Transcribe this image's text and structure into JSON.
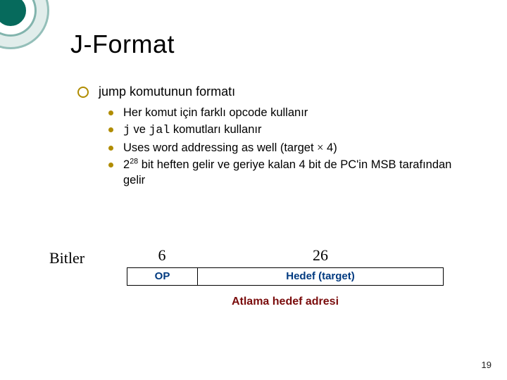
{
  "title": "J-Format",
  "lvl1_text": "jump komutunun formatı",
  "sub": {
    "a": "Her komut için farklı opcode kullanır",
    "b_pre": "j",
    "b_mid": " ve ",
    "b_code2": "jal",
    "b_post": " komutları kullanır",
    "c_pre": "Uses word addressing as well (target ",
    "c_mult": "×",
    "c_post": " 4)",
    "d_pre": "2",
    "d_sup": "28",
    "d_post": " bit heften gelir ve geriye kalan 4 bit de PC'in MSB tarafından gelir"
  },
  "diagram": {
    "label": "Bitler",
    "bits6": "6",
    "bits26": "26",
    "op": "OP",
    "target": "Hedef (target)",
    "caption": "Atlama hedef adresi"
  },
  "page": "19"
}
